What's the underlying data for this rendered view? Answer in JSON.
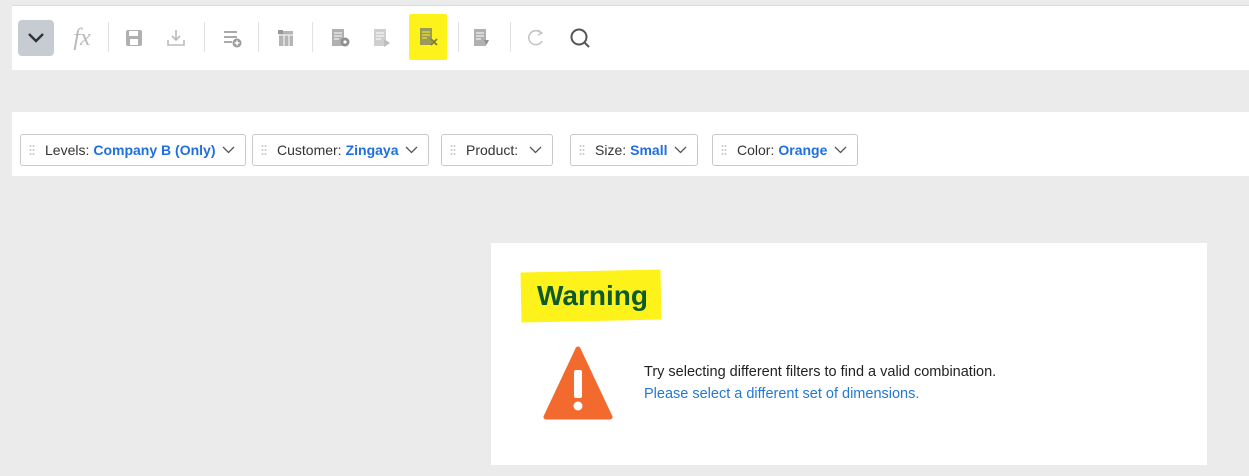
{
  "toolbar": {
    "fx_label": "fx",
    "highlight_color": "#fdf21a",
    "icons": [
      "chevron-down-icon",
      "fx-icon",
      "save-icon",
      "download-icon",
      "list-add-icon",
      "table-icon",
      "data-settings-icon",
      "export-icon",
      "data-x-icon",
      "data-edit-icon",
      "refresh-icon",
      "search-icon"
    ]
  },
  "filters": [
    {
      "label": "Levels:",
      "value": "Company B (Only)"
    },
    {
      "label": "Customer:",
      "value": "Zingaya"
    },
    {
      "label": "Product:",
      "value": ""
    },
    {
      "label": "Size:",
      "value": "Small"
    },
    {
      "label": "Color:",
      "value": "Orange"
    }
  ],
  "warning": {
    "title": "Warning",
    "message": "Try selecting different filters to find a valid combination.",
    "link": "Please select a different set of dimensions.",
    "icon_color": "#f26a2e",
    "title_color": "#0f5a2b"
  }
}
